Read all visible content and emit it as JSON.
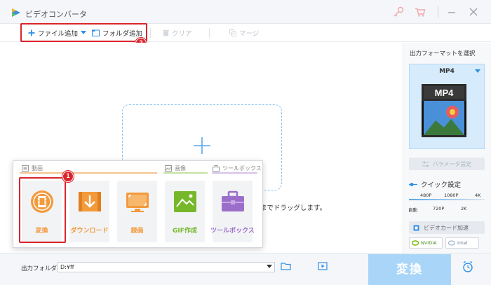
{
  "window": {
    "title": "ビデオコンバータ"
  },
  "toolbar": {
    "add_file_label": "ファイル追加",
    "add_folder_label": "フォルダ追加",
    "clear_label": "クリア",
    "merge_label": "マージ"
  },
  "callouts": {
    "first": "1",
    "second": "2"
  },
  "drop_zone": {
    "hint": "までドラッグします。"
  },
  "tool_menu": {
    "categories": {
      "video": "動画",
      "image": "画像",
      "toolbox": "ツールボックス"
    },
    "tiles": [
      {
        "label": "変換",
        "icon": "film-convert-icon",
        "color": "#f39a3c"
      },
      {
        "label": "ダウンロード",
        "icon": "download-icon",
        "color": "#f39a3c"
      },
      {
        "label": "録画",
        "icon": "screen-record-icon",
        "color": "#f39a3c"
      },
      {
        "label": "GIF作成",
        "icon": "gif-image-icon",
        "color": "#76b82a"
      },
      {
        "label": "ツールボックス",
        "icon": "toolbox-icon",
        "color": "#9b6fc9"
      }
    ]
  },
  "sidebar": {
    "format_heading": "出力フォーマットを選択",
    "format_name": "MP4",
    "format_badge": "MP4",
    "parameter_button": "パラメータ設定",
    "quick_setting_label": "クイック設定",
    "quality_top": [
      "480P",
      "1080P",
      "4K"
    ],
    "quality_bottom": [
      "自動",
      "720P",
      "2K"
    ],
    "gpu_label": "ビデオカード加速",
    "vendors": [
      "NVIDIA",
      "Intel"
    ]
  },
  "bottom": {
    "output_label": "出力フォルダ：",
    "output_path": "D:¥ff",
    "convert_label": "変換"
  },
  "colors": {
    "accent_blue": "#2f8fe6",
    "highlight_red": "#d9252c",
    "convert_button": "#a9d6f8"
  }
}
